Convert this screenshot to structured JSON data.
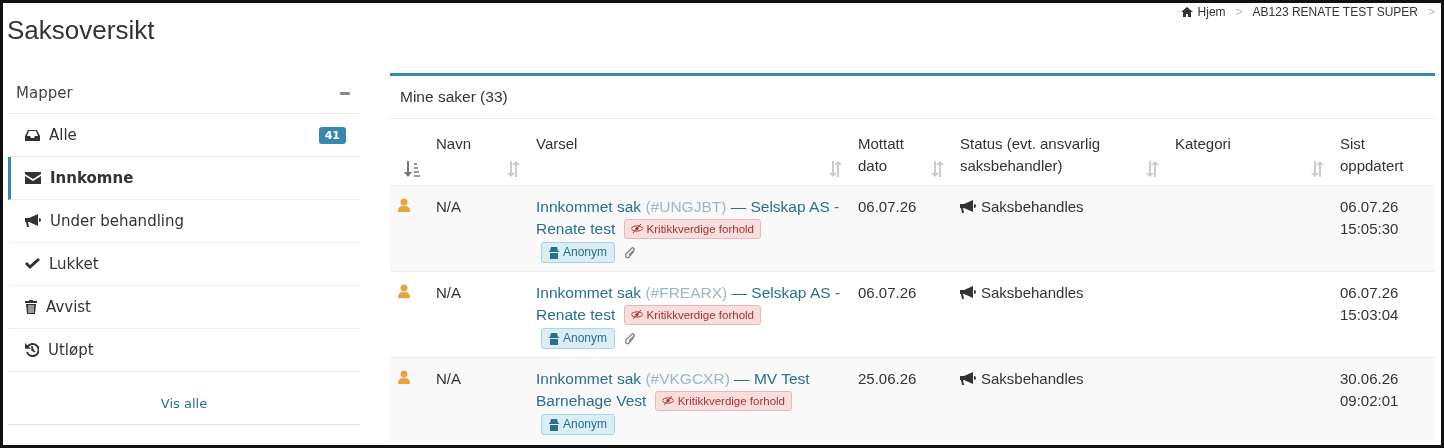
{
  "page": {
    "title": "Saksoversikt"
  },
  "breadcrumb": [
    {
      "kind": "home",
      "label": "Hjem"
    },
    {
      "kind": "separator",
      "label": ">"
    },
    {
      "kind": "link",
      "label": "AB123 RENATE TEST SUPER"
    },
    {
      "kind": "separator",
      "label": ">"
    }
  ],
  "sidebar": {
    "title": "Mapper",
    "collapsed": false,
    "items": [
      {
        "label": "Alle",
        "badge": "41",
        "selected": false
      },
      {
        "label": "Innkomne",
        "selected": true
      },
      {
        "label": "Under behandling",
        "selected": false
      },
      {
        "label": "Lukket",
        "selected": false
      },
      {
        "label": "Avvist",
        "selected": false
      },
      {
        "label": "Utløpt",
        "selected": false
      }
    ],
    "show_all": "Vis alle"
  },
  "cases": {
    "title": "Mine saker (33)",
    "columns": [
      {
        "kind": "sort-toggle"
      },
      {
        "kind": "text",
        "label": "Navn",
        "sortable": true
      },
      {
        "kind": "text",
        "label": "Varsel",
        "sortable": true
      },
      {
        "kind": "text",
        "label": "Mottatt dato",
        "sortable": true
      },
      {
        "kind": "text",
        "label": "Status (evt. ansvarlig saksbehandler)",
        "sortable": true
      },
      {
        "kind": "text",
        "label": "Kategori",
        "sortable": true
      },
      {
        "kind": "text",
        "label": "Sist oppdatert",
        "sortable": false
      }
    ],
    "rows": [
      {
        "name": "N/A",
        "case_title": "Innkommet sak",
        "case_code": "(#UNGJBT)",
        "case_rest": "— Selskap AS - Renate test",
        "flag": "Kritikkverdige forhold",
        "reporter_tag": "Anonym",
        "attachment": true,
        "received": "06.07.26",
        "status": "Saksbehandles",
        "updated": "06.07.26 15:05:30"
      },
      {
        "name": "N/A",
        "case_title": "Innkommet sak",
        "case_code": "(#FREARX)",
        "case_rest": "— Selskap AS - Renate test",
        "flag": "Kritikkverdige forhold",
        "reporter_tag": "Anonym",
        "attachment": true,
        "received": "06.07.26",
        "status": "Saksbehandles",
        "updated": "06.07.26 15:03:04"
      },
      {
        "name": "N/A",
        "case_title": "Innkommet sak",
        "case_code": "(#VKGCXR)",
        "case_rest": "— MV Test Barnehage Vest",
        "flag": "Kritikkverdige forhold",
        "reporter_tag": "Anonym",
        "attachment": false,
        "received": "25.06.26",
        "status": "Saksbehandles",
        "updated": "30.06.26 09:02:01"
      }
    ]
  }
}
